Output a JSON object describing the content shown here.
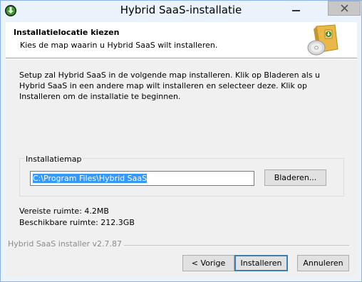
{
  "window": {
    "title": "Hybrid SaaS-installatie"
  },
  "header": {
    "title": "Installatielocatie kiezen",
    "subtitle": "Kies de map waarin u Hybrid SaaS wilt installeren."
  },
  "description": "Setup zal Hybrid SaaS in de volgende map installeren. Klik op Bladeren als u Hybrid SaaS in een andere map wilt installeren en selecteer deze. Klik op Installeren om de installatie te beginnen.",
  "destination": {
    "group_label": "Installatiemap",
    "path": "C:\\Program Files\\Hybrid SaaS",
    "browse_label": "Bladeren..."
  },
  "space": {
    "required": "Vereiste ruimte: 4.2MB",
    "available": "Beschikbare ruimte: 212.3GB"
  },
  "branding": "Hybrid SaaS installer v2.7.87",
  "buttons": {
    "back": "< Vorige",
    "install": "Installeren",
    "cancel": "Annuleren"
  },
  "colors": {
    "selection": "#3399ff",
    "title_bar": "#eaf2fb",
    "dialog_bg": "#f0f0f0"
  },
  "icons": {
    "app": "download-arrow-icon",
    "header": "installer-box-cd-icon"
  }
}
